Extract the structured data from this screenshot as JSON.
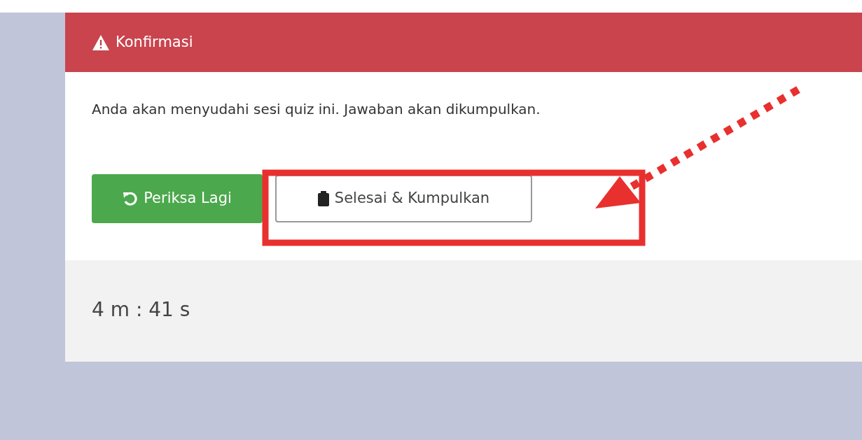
{
  "modal": {
    "title": "Konfirmasi",
    "message": "Anda akan menyudahi sesi quiz ini. Jawaban akan dikumpulkan.",
    "buttons": [
      {
        "kind": "review",
        "label": "Periksa Lagi"
      },
      {
        "kind": "submit",
        "label": "Selesai & Kumpulkan"
      }
    ],
    "footer": {
      "timer": "4 m : 41 s"
    }
  }
}
